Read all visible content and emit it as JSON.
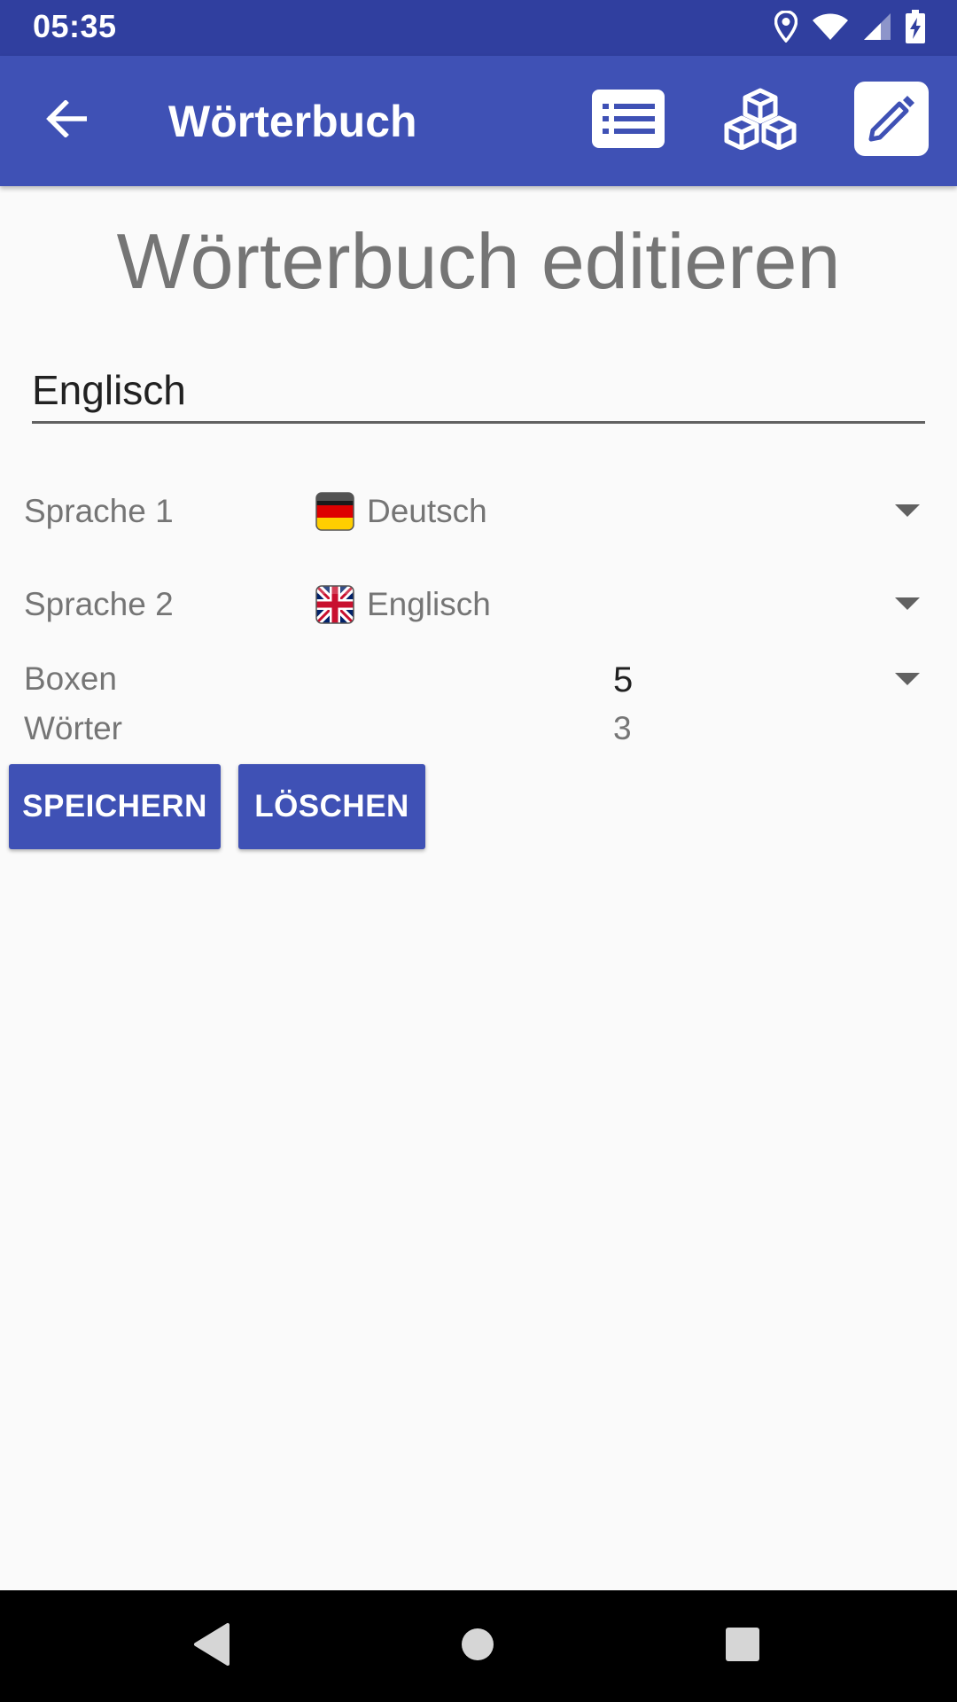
{
  "status_bar": {
    "time": "05:35",
    "icons": [
      "location-icon",
      "wifi-icon",
      "cell-signal-icon",
      "battery-charging-icon"
    ]
  },
  "app_bar": {
    "title": "Wörterbuch",
    "back_icon": "arrow-back-icon",
    "actions": [
      "list-icon",
      "boxes-icon",
      "edit-icon"
    ]
  },
  "form": {
    "heading": "Wörterbuch editieren",
    "name_value": "Englisch",
    "language1": {
      "label": "Sprache 1",
      "value": "Deutsch",
      "flag": "german-flag-icon"
    },
    "language2": {
      "label": "Sprache 2",
      "value": "Englisch",
      "flag": "uk-flag-icon"
    },
    "boxes": {
      "label": "Boxen",
      "value": "5"
    },
    "words": {
      "label": "Wörter",
      "value": "3"
    }
  },
  "buttons": {
    "save": "SPEICHERN",
    "delete": "LÖSCHEN"
  },
  "colors": {
    "status_bar": "#303f9f",
    "primary": "#3f51b5",
    "background": "#fafafa"
  }
}
